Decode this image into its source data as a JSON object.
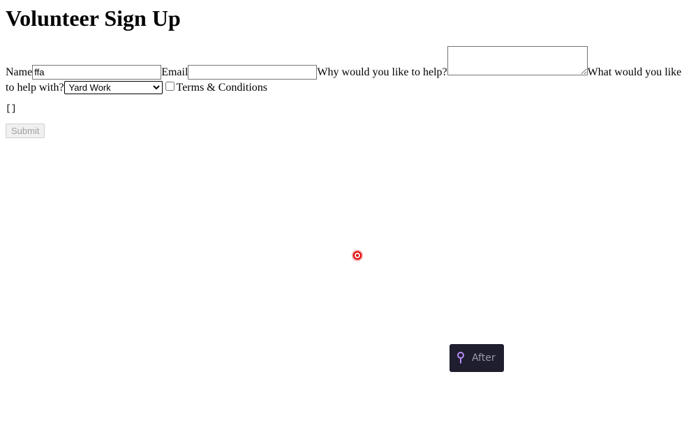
{
  "page": {
    "title": "Volunteer Sign Up"
  },
  "form": {
    "name_label": "Name",
    "name_value": "ffa",
    "email_label": "Email",
    "email_value": "",
    "reason_label": "Why would you like to help?",
    "reason_value": "",
    "task_label": "What would you like to help with?",
    "task_selected": "Yard Work",
    "terms_label": "Terms & Conditions",
    "terms_checked": false
  },
  "output": {
    "text": "[]"
  },
  "submit": {
    "label": "Submit",
    "disabled": true
  },
  "overlay": {
    "after_label": "After",
    "after_icon": "pin-icon",
    "cursor_color": "#e00000",
    "badge_bg": "#1e1e2e",
    "pin_color": "#b98cff"
  }
}
